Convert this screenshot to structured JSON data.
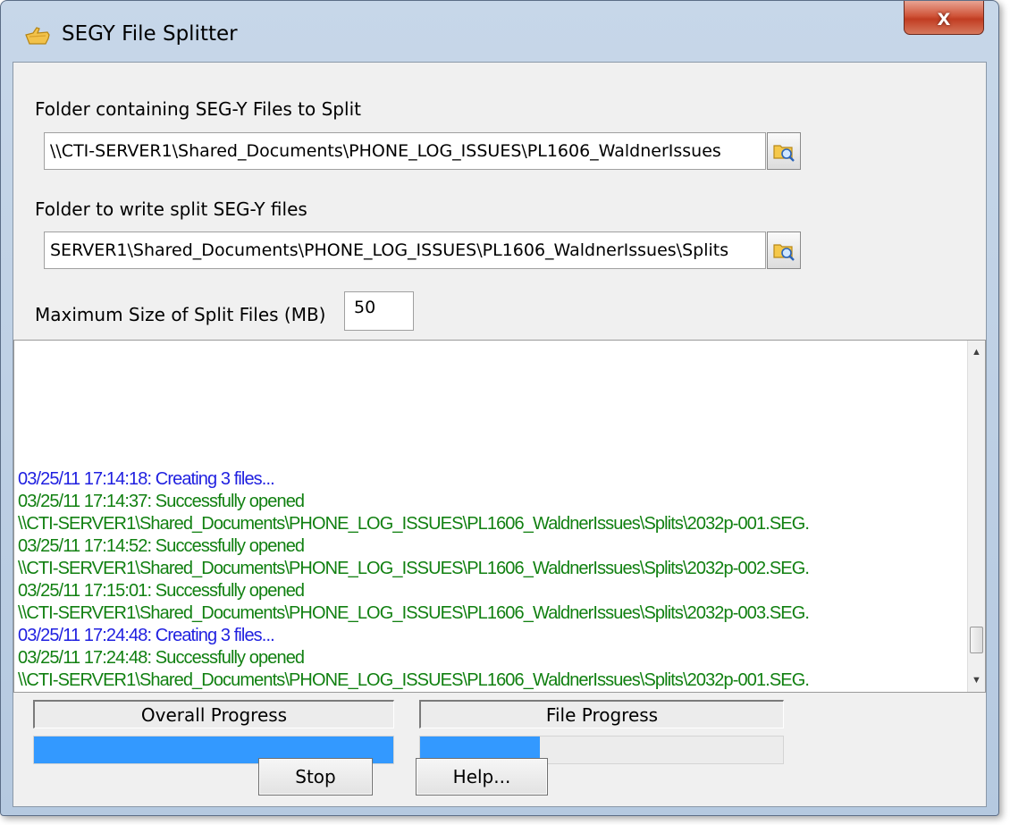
{
  "window": {
    "title": "SEGY File Splitter",
    "close_label": "x"
  },
  "source": {
    "label": "Folder containing SEG-Y Files to Split",
    "value": "\\\\CTI-SERVER1\\Shared_Documents\\PHONE_LOG_ISSUES\\PL1606_WaldnerIssues"
  },
  "output": {
    "label": "Folder to write split SEG-Y files",
    "value": "SERVER1\\Shared_Documents\\PHONE_LOG_ISSUES\\PL1606_WaldnerIssues\\Splits"
  },
  "max_size": {
    "label": "Maximum Size of Split Files (MB)",
    "value": "50"
  },
  "log": [
    {
      "text": "03/25/11 17:14:18: Creating 3 files...",
      "kind": "info"
    },
    {
      "text": "03/25/11 17:14:37: Successfully opened",
      "kind": "ok"
    },
    {
      "text": "\\\\CTI-SERVER1\\Shared_Documents\\PHONE_LOG_ISSUES\\PL1606_WaldnerIssues\\Splits\\2032p-001.SEG.",
      "kind": "ok"
    },
    {
      "text": "03/25/11 17:14:52: Successfully opened",
      "kind": "ok"
    },
    {
      "text": "\\\\CTI-SERVER1\\Shared_Documents\\PHONE_LOG_ISSUES\\PL1606_WaldnerIssues\\Splits\\2032p-002.SEG.",
      "kind": "ok"
    },
    {
      "text": "03/25/11 17:15:01: Successfully opened",
      "kind": "ok"
    },
    {
      "text": "\\\\CTI-SERVER1\\Shared_Documents\\PHONE_LOG_ISSUES\\PL1606_WaldnerIssues\\Splits\\2032p-003.SEG.",
      "kind": "ok"
    },
    {
      "text": "03/25/11 17:24:48: Creating 3 files...",
      "kind": "info"
    },
    {
      "text": "03/25/11 17:24:48: Successfully opened",
      "kind": "ok"
    },
    {
      "text": "\\\\CTI-SERVER1\\Shared_Documents\\PHONE_LOG_ISSUES\\PL1606_WaldnerIssues\\Splits\\2032p-001.SEG.",
      "kind": "ok"
    }
  ],
  "log_scroll_fraction": 0.94,
  "progress": {
    "overall": {
      "label": "Overall Progress",
      "fraction": 1.0
    },
    "file": {
      "label": "File Progress",
      "fraction": 0.33
    }
  },
  "buttons": {
    "stop": "Stop",
    "help": "Help..."
  },
  "colors": {
    "progress_fill": "#3399ff",
    "log_info": "#1f1fe0",
    "log_ok": "#118011"
  },
  "icons": {
    "app": "folder-hand-icon",
    "browse": "folder-search-icon"
  }
}
